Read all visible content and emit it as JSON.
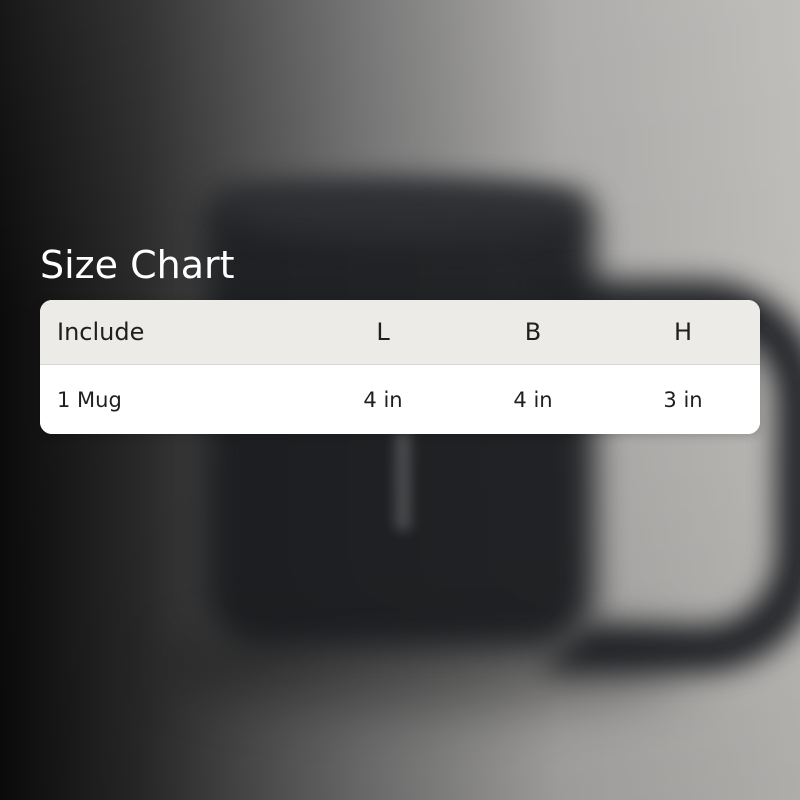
{
  "title": "Size Chart",
  "table": {
    "headers": [
      "Include",
      "L",
      "B",
      "H"
    ],
    "rows": [
      [
        "1 Mug",
        "4 in",
        "4 in",
        "3 in"
      ]
    ]
  },
  "colors": {
    "header_bg": "#ecebe8",
    "card_bg": "#ffffff",
    "title_text": "#ffffff",
    "table_text": "#1f1f1f"
  }
}
